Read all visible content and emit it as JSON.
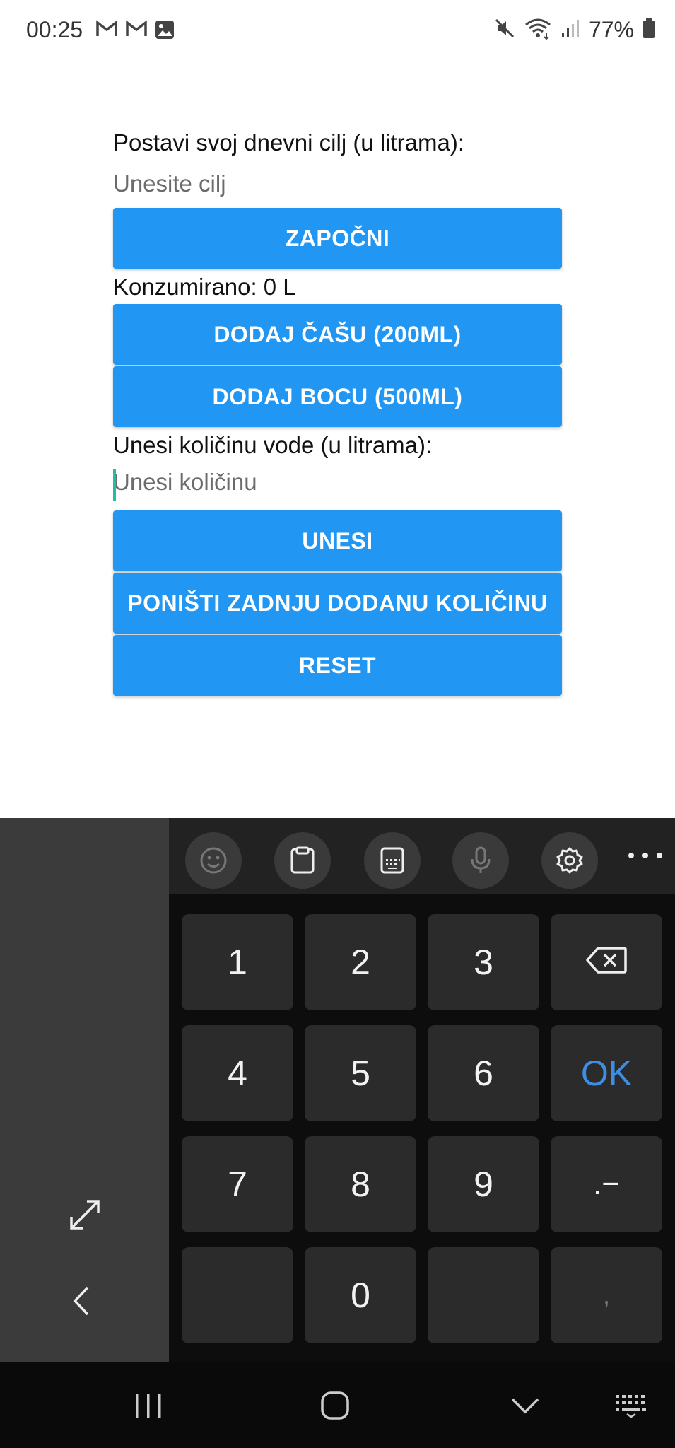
{
  "status_bar": {
    "time": "00:25",
    "battery": "77%",
    "notification_icons": [
      "gmail-icon",
      "gmail-icon",
      "image-icon"
    ],
    "system_icons": [
      "mute-icon",
      "wifi-icon",
      "signal-icon",
      "battery-icon"
    ]
  },
  "app": {
    "goal_label": "Postavi svoj dnevni cilj (u litrama):",
    "goal_input_placeholder": "Unesite cilj",
    "start_button": "ZAPOČNI",
    "consumed_text": "Konzumirano: 0 L",
    "add_glass_button": "DODAJ ČAŠU (200ML)",
    "add_bottle_button": "DODAJ BOCU (500ML)",
    "amount_label": "Unesi količinu vode (u litrama):",
    "amount_input_placeholder": "Unesi količinu",
    "submit_button": "UNESI",
    "undo_button": "PONIŠTI ZADNJU DODANU KOLIČINU",
    "reset_button": "RESET",
    "accent_color": "#2196f3"
  },
  "keyboard": {
    "toolbar_icons": [
      "emoji-icon",
      "clipboard-icon",
      "keyboard-mode-icon",
      "microphone-icon",
      "settings-icon",
      "more-icon"
    ],
    "keys": {
      "k1": "1",
      "k2": "2",
      "k3": "3",
      "k4": "4",
      "k5": "5",
      "k6": "6",
      "k7": "7",
      "k8": "8",
      "k9": "9",
      "k0": "0",
      "ok": "OK",
      "dot_minus": ".−",
      "comma": ","
    }
  },
  "nav_bar": {
    "icons": [
      "recent-apps-icon",
      "home-icon",
      "back-icon",
      "keyboard-switch-icon"
    ]
  }
}
